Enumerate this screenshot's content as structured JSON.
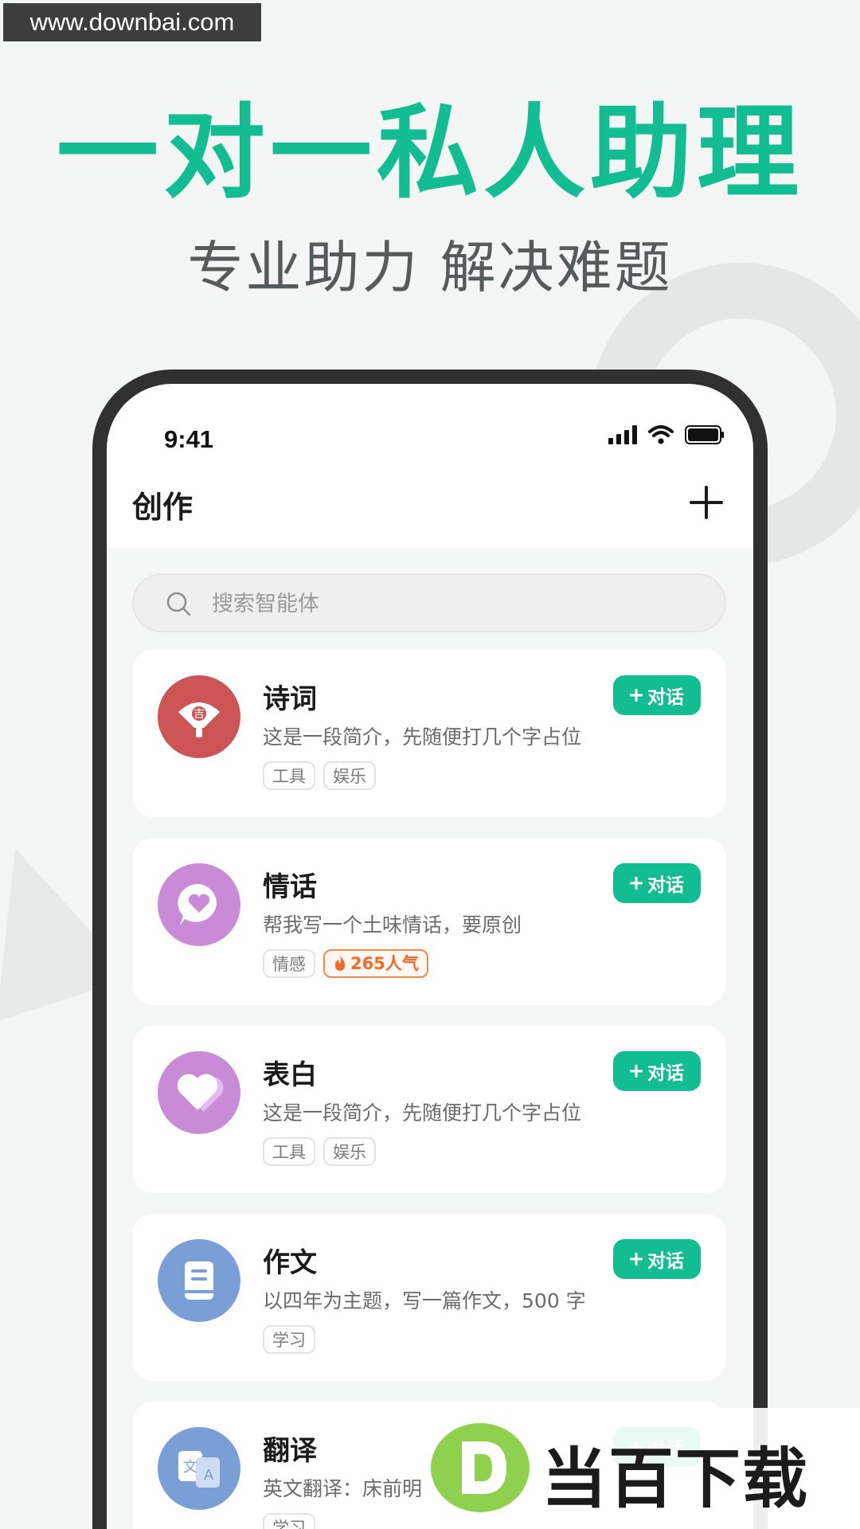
{
  "watermark": "www.downbai.com",
  "promo": {
    "headline": "一对一私人助理",
    "subline": "专业助力 解决难题"
  },
  "status_bar": {
    "time": "9:41"
  },
  "app_bar": {
    "title": "创作"
  },
  "search": {
    "placeholder": "搜索智能体"
  },
  "chat_button_label": "对话",
  "agents": [
    {
      "title": "诗词",
      "desc": "这是一段简介，先随便打几个字占位",
      "tags": [
        "工具",
        "娱乐"
      ],
      "hot": "",
      "icon": "fan-icon",
      "color": "#cc5455"
    },
    {
      "title": "情话",
      "desc": "帮我写一个土味情话，要原创",
      "tags": [
        "情感"
      ],
      "hot": "265人气",
      "icon": "heart-chat-icon",
      "color": "#c98bd8"
    },
    {
      "title": "表白",
      "desc": "这是一段简介，先随便打几个字占位",
      "tags": [
        "工具",
        "娱乐"
      ],
      "hot": "",
      "icon": "heart-icon",
      "color": "#c98bd8"
    },
    {
      "title": "作文",
      "desc": "以四年为主题，写一篇作文，500 字",
      "tags": [
        "学习"
      ],
      "hot": "",
      "icon": "book-icon",
      "color": "#7a9fd6"
    },
    {
      "title": "翻译",
      "desc": "英文翻译：床前明",
      "tags": [
        "学习"
      ],
      "hot": "",
      "icon": "translate-icon",
      "color": "#7a9fd6"
    }
  ],
  "brand": {
    "text": "当百下载"
  }
}
